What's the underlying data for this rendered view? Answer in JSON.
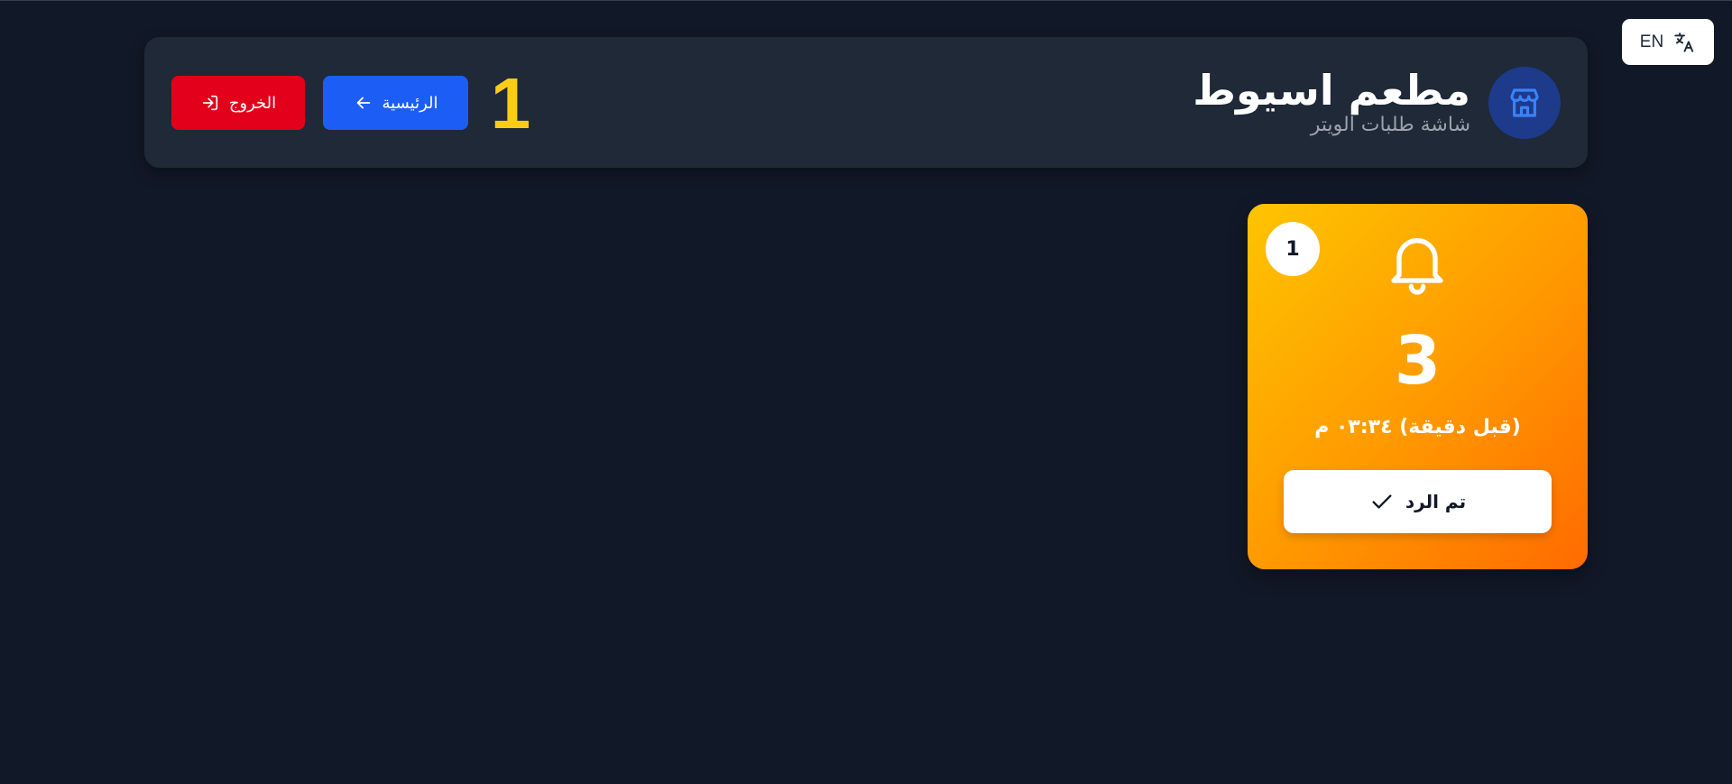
{
  "language_toggle": {
    "label": "EN",
    "icon": "translate-icon"
  },
  "header": {
    "restaurant_name": "مطعم اسيوط",
    "subtitle": "شاشة طلبات الويتر",
    "store_icon": "store-icon",
    "page_counter": "1",
    "home_button": {
      "label": "الرئيسية",
      "icon": "arrow-left-icon"
    },
    "logout_button": {
      "label": "الخروج",
      "icon": "logout-icon"
    }
  },
  "calls": [
    {
      "badge": "1",
      "icon": "bell-icon",
      "number": "3",
      "time": "(قبل دقيقة) ٠٣:٣٤ م",
      "action_label": "تم الرد",
      "action_icon": "check-icon"
    }
  ],
  "colors": {
    "background": "#111827",
    "header_card": "#1f2937",
    "logout": "#e3001b",
    "home": "#1c5ef5",
    "counter": "#facc15",
    "card_gradient_start": "#fec400",
    "card_gradient_end": "#ff6b00"
  }
}
